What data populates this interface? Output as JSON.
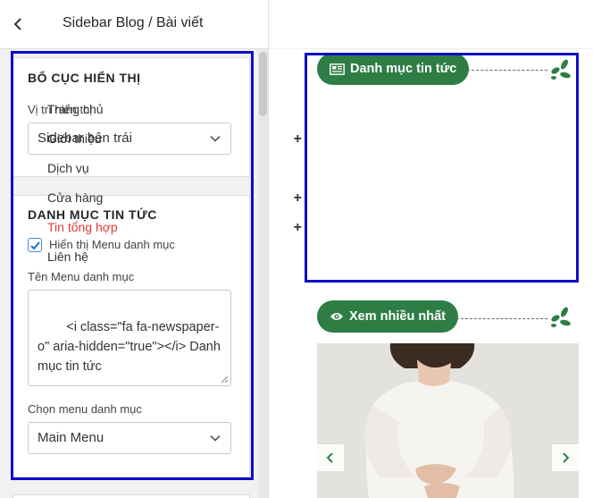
{
  "panel": {
    "title": "Sidebar Blog / Bài viết",
    "back_icon": "chevron-left-icon"
  },
  "layout_section": {
    "title": "BỐ CỤC HIỂN THỊ",
    "position_label": "Vị trí hiển thị",
    "position_value": "Sidebar bên trái"
  },
  "category_section": {
    "title": "DANH MỤC TIN TỨC",
    "show_menu_label": "Hiển thị Menu danh mục",
    "show_menu_checked": true,
    "menu_name_label": "Tên Menu danh mục",
    "menu_name_value": "<i class=\"fa fa-newspaper-o\" aria-hidden=\"true\"></i> Danh mục tin tức",
    "choose_menu_label": "Chọn menu danh mục",
    "choose_menu_value": "Main Menu"
  },
  "preview": {
    "category_heading": "Danh mục tin tức",
    "category_icon": "newspaper-icon",
    "menu_items": [
      {
        "label": "Trang chủ",
        "has_children": false,
        "active": false
      },
      {
        "label": "Giới thiệu",
        "has_children": true,
        "active": false
      },
      {
        "label": "Dịch vụ",
        "has_children": false,
        "active": false
      },
      {
        "label": "Cửa hàng",
        "has_children": true,
        "active": false
      },
      {
        "label": "Tin tổng hợp",
        "has_children": true,
        "active": true
      },
      {
        "label": "Liên hệ",
        "has_children": false,
        "active": false
      }
    ],
    "expand_symbol": "+",
    "most_viewed_heading": "Xem nhiều nhất",
    "most_viewed_icon": "eye-icon"
  },
  "colors": {
    "accent_green": "#2e7d45",
    "highlight_outline": "#0c0ccc",
    "active_link": "#e03a3a"
  }
}
